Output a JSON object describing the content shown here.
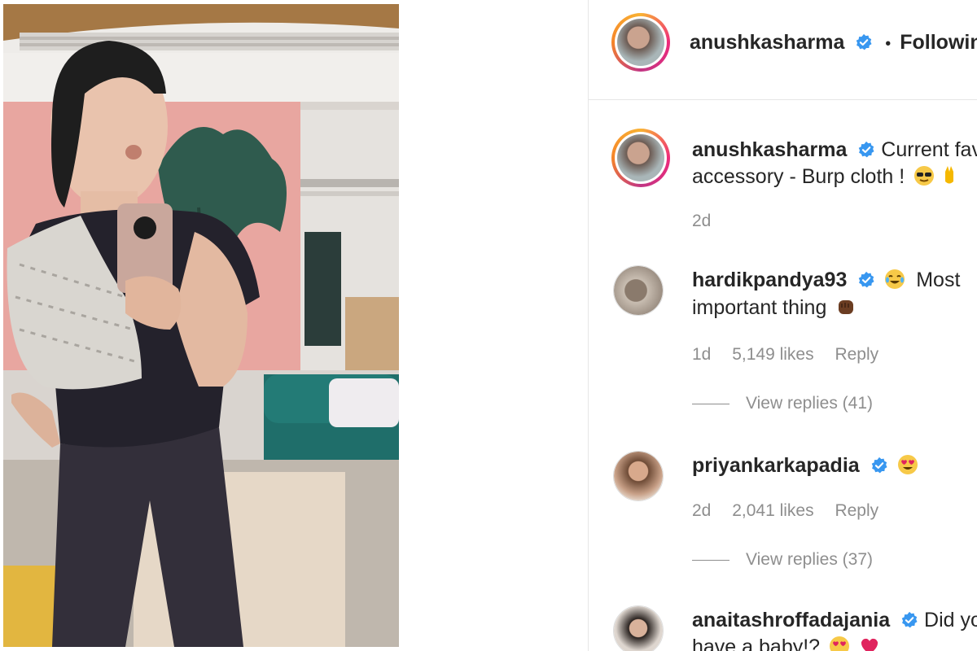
{
  "colors": {
    "verified": "#3897f0",
    "username": "#262626",
    "meta": "#8e8e8e",
    "follow": "#262626"
  },
  "header": {
    "username": "anushkasharma",
    "separator": "•",
    "follow_label": "Following"
  },
  "caption": {
    "username": "anushkasharma",
    "text_line1": "Current fav",
    "text_line2": "accessory - Burp cloth !",
    "time": "2d"
  },
  "comments": [
    {
      "username": "hardikpandya93",
      "text_line1": "Most",
      "text_line2": "important thing",
      "time": "1d",
      "likes": "5,149 likes",
      "reply_label": "Reply",
      "view_replies": "View replies (41)"
    },
    {
      "username": "priyankarkapadia",
      "text_line1": "",
      "time": "2d",
      "likes": "2,041 likes",
      "reply_label": "Reply",
      "view_replies": "View replies (37)"
    },
    {
      "username": "anaitashroffadajania",
      "text_line1": "Did yo",
      "text_line2": "have a baby!?"
    }
  ]
}
